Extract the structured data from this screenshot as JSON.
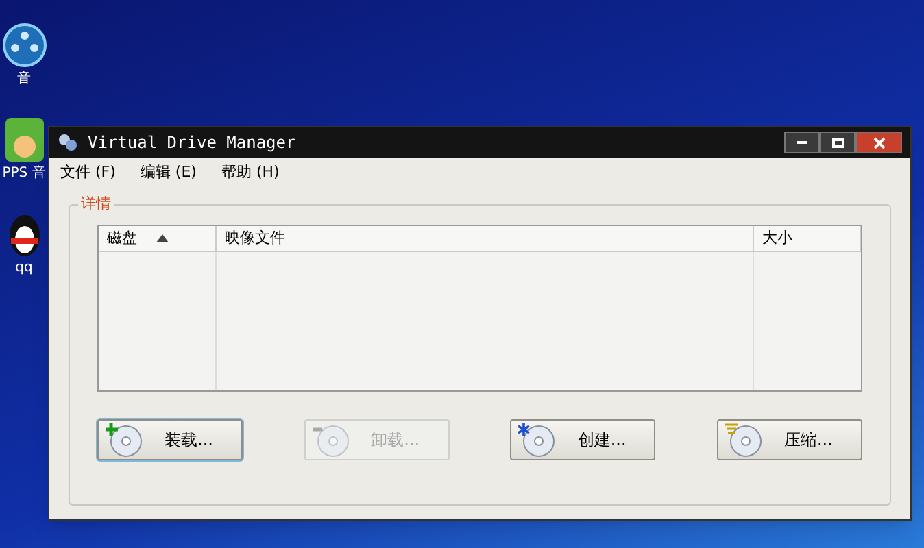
{
  "desktop_icons": [
    {
      "label": "音",
      "kind": "player"
    },
    {
      "label": "PPS 音",
      "kind": "pps"
    },
    {
      "label": "qq",
      "kind": "penguin"
    }
  ],
  "window": {
    "title": "Virtual Drive Manager"
  },
  "menu": [
    "文件 (F)",
    "编辑 (E)",
    "帮助 (H)"
  ],
  "group": {
    "title": "详情"
  },
  "table": {
    "columns": [
      {
        "label": "磁盘",
        "sorted": true
      },
      {
        "label": "映像文件",
        "sorted": false
      },
      {
        "label": "大小",
        "sorted": false
      }
    ]
  },
  "buttons": [
    {
      "label": "装载...",
      "kind": "plus",
      "disabled": false
    },
    {
      "label": "卸载...",
      "kind": "minus",
      "disabled": true
    },
    {
      "label": "创建...",
      "kind": "star",
      "disabled": false
    },
    {
      "label": "压缩...",
      "kind": "lines",
      "disabled": false
    }
  ]
}
